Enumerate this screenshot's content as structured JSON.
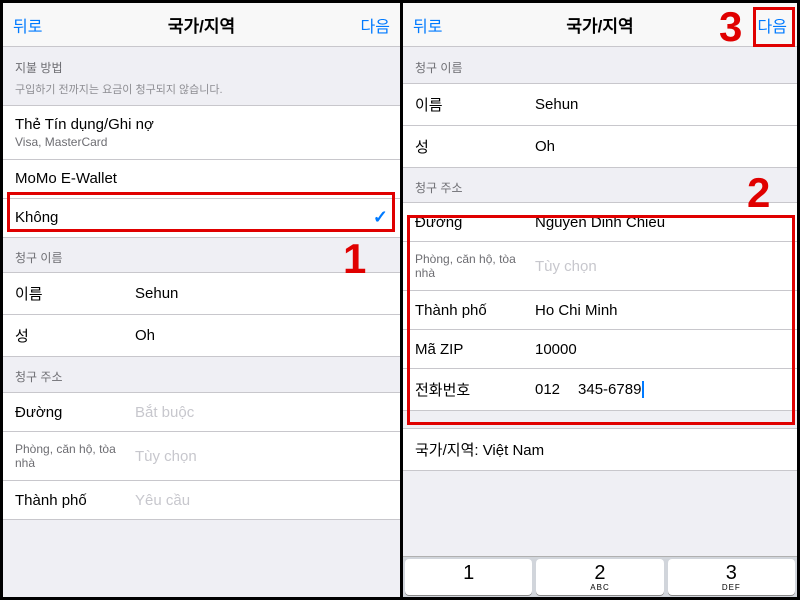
{
  "nav": {
    "back": "뒤로",
    "title": "국가/지역",
    "next": "다음"
  },
  "left": {
    "payment_header": "지불 방법",
    "payment_sub": "구입하기 전까지는 요금이 청구되지 않습니다.",
    "opt_card": "Thẻ Tín dụng/Ghi nợ",
    "opt_card_sub": "Visa, MasterCard",
    "opt_momo": "MoMo E-Wallet",
    "opt_none": "Không",
    "billing_name_header": "청구 이름",
    "first_label": "이름",
    "first_value": "Sehun",
    "last_label": "성",
    "last_value": "Oh",
    "billing_addr_header": "청구 주소",
    "street_label": "Đường",
    "street_ph": "Bắt buộc",
    "apt_label": "Phòng, căn hộ, tòa nhà",
    "apt_ph": "Tùy chọn",
    "city_label": "Thành phố",
    "city_ph": "Yêu cầu"
  },
  "right": {
    "billing_name_header": "청구 이름",
    "first_label": "이름",
    "first_value": "Sehun",
    "last_label": "성",
    "last_value": "Oh",
    "billing_addr_header": "청구 주소",
    "street_label": "Đường",
    "street_value": "Nguyen Dinh Chieu",
    "apt_label": "Phòng, căn hộ, tòa nhà",
    "apt_ph": "Tùy chọn",
    "city_label": "Thành phố",
    "city_value": "Ho Chi Minh",
    "zip_label": "Mã ZIP",
    "zip_value": "10000",
    "phone_label": "전화번호",
    "phone_cc": "012",
    "phone_num": "345-6789",
    "country_row": "국가/지역: Việt Nam"
  },
  "keys": [
    {
      "n": "1",
      "l": ""
    },
    {
      "n": "2",
      "l": "ABC"
    },
    {
      "n": "3",
      "l": "DEF"
    }
  ],
  "annotations": {
    "one": "1",
    "two": "2",
    "three": "3"
  }
}
